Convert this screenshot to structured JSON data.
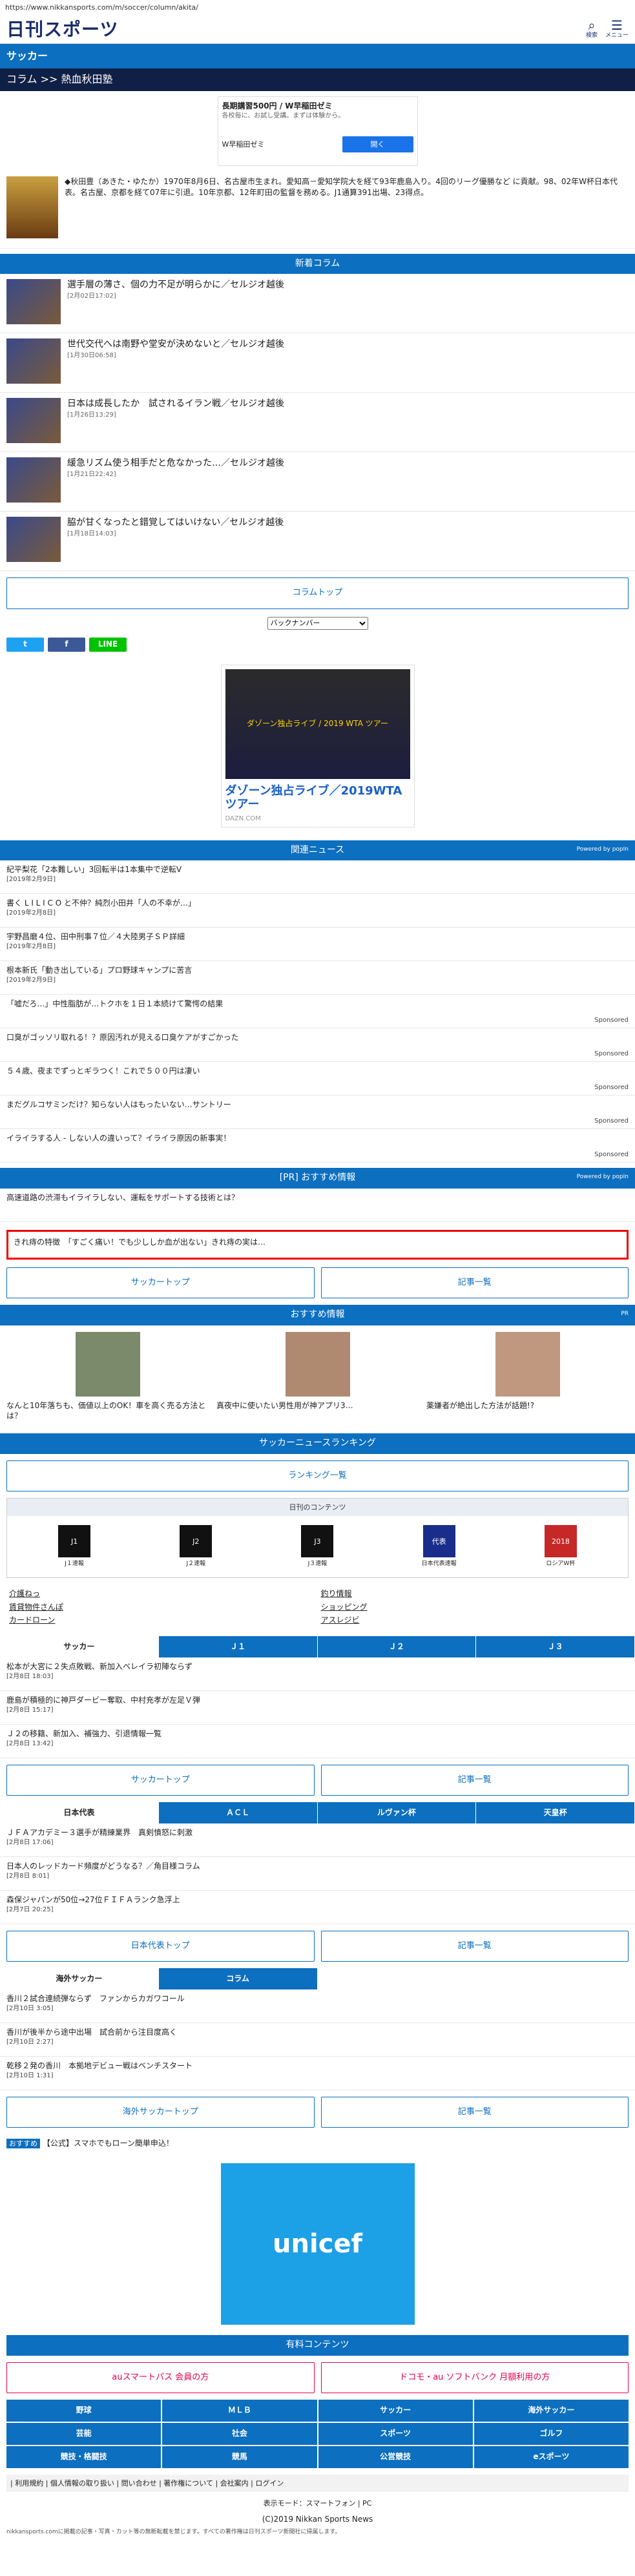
{
  "browser": {
    "url": "https://www.nikkansports.com/m/soccer/column/akita/"
  },
  "header": {
    "logo": "日刊スポーツ",
    "search_label": "検索",
    "menu_label": "メニュー"
  },
  "section": {
    "title": "サッカー",
    "breadcrumb": "コラム >> 熱血秋田塾"
  },
  "ad_top": {
    "title": "長期講習500円 / W早稲田ゼミ",
    "desc": "各校毎に、お試し受講。まずは体験から。",
    "advertiser": "W早稲田ゼミ",
    "cta": "開く"
  },
  "profile": {
    "text": "◆秋田豊（あきた・ゆたか）1970年8月6日、名古屋市生まれ。愛知高－愛知学院大を経て93年鹿島入り。4回のリーグ優勝など に貢献。98、02年W杯日本代表。名古屋、京都を経て07年に引退。10年京都、12年町田の監督を務める。J1通算391出場、23得点。"
  },
  "columns": {
    "title": "新着コラム",
    "items": [
      {
        "title": "選手層の薄さ、個の力不足が明らかに／セルジオ越後",
        "date": "[2月02日17:02]"
      },
      {
        "title": "世代交代へは南野や堂安が決めないと／セルジオ越後",
        "date": "[1月30日06:58]"
      },
      {
        "title": "日本は成長したか　試されるイラン戦／セルジオ越後",
        "date": "[1月26日13:29]"
      },
      {
        "title": "緩急リズム使う相手だと危なかった…／セルジオ越後",
        "date": "[1月21日22:42]"
      },
      {
        "title": "脇が甘くなったと錯覚してはいけない／セルジオ越後",
        "date": "[1月18日14:03]"
      }
    ],
    "top_button": "コラムトップ"
  },
  "backnumber": {
    "label": "バックナンバー"
  },
  "share": {
    "twitter": "t",
    "facebook": "f",
    "line": "LINE"
  },
  "banner_ad": {
    "image_text": "ダゾーン独占ライブ / 2019 WTA ツアー",
    "title": "ダゾーン独占ライブ／2019WTAツアー",
    "source": "DAZN.COM"
  },
  "related": {
    "title": "関連ニュース",
    "powered": "Powered by popIn",
    "items": [
      {
        "title": "紀平梨花「2本難しい」3回転半は1本集中で逆転V",
        "date": "[2019年2月9日]",
        "sponsored": ""
      },
      {
        "title": "書く L I L I C O と不仲？純烈小田井「人の不幸が…」",
        "date": "[2019年2月8日]",
        "sponsored": ""
      },
      {
        "title": "宇野昌磨４位、田中刑事７位／４大陸男子ＳＰ詳細",
        "date": "[2019年2月8日]",
        "sponsored": ""
      },
      {
        "title": "根本新氏「動き出している」プロ野球キャンプに苦言",
        "date": "[2019年2月9日]",
        "sponsored": ""
      },
      {
        "title": "「嘘だろ…」中性脂肪が…トクホを１日１本続けて驚愕の結果",
        "date": "",
        "sponsored": "Sponsored"
      },
      {
        "title": "口臭がゴッソリ取れる！？原因汚れが見える口臭ケアがすごかった",
        "date": "",
        "sponsored": "Sponsored"
      },
      {
        "title": "５４歳、夜までずっとギラつく！これで５００円は凄い",
        "date": "",
        "sponsored": "Sponsored"
      },
      {
        "title": "まだグルコサミンだけ？知らない人はもったいない…サントリー",
        "date": "",
        "sponsored": "Sponsored"
      },
      {
        "title": "イライラする人 - しない人の違いって？イライラ原因の新事実！",
        "date": "",
        "sponsored": "Sponsored"
      }
    ]
  },
  "pr": {
    "title": "[PR] おすすめ情報",
    "powered": "Powered by popIn",
    "item": "高速道路の渋滞もイライラしない、運転をサポートする技術とは？"
  },
  "red_box": {
    "text": "きれ痔の特徴　「すごく痛い！でも少ししか血が出ない」きれ痔の実は…"
  },
  "nav1": {
    "left": "サッカートップ",
    "right": "記事一覧"
  },
  "osusume": {
    "title": "おすすめ情報",
    "pr": "PR",
    "items": [
      {
        "text": "なんと10年落ちも、価値以上のOK！車を高く売る方法とは？"
      },
      {
        "text": "真夜中に使いたい男性用が神アプリ3…"
      },
      {
        "text": "薬嫌者が絶出した方法が話題!?"
      }
    ]
  },
  "ranking": {
    "title": "サッカーニュースランキング",
    "button": "ランキング一覧"
  },
  "mycontent": {
    "title": "日刊のコンテンツ",
    "logos": [
      {
        "badge": "J1",
        "label": "J１速報"
      },
      {
        "badge": "J2",
        "label": "J２速報"
      },
      {
        "badge": "J3",
        "label": "J３速報"
      },
      {
        "badge": "代表",
        "label": "日本代表速報"
      },
      {
        "badge": "2018",
        "label": "ロシアW杯"
      }
    ]
  },
  "links": [
    {
      "label": "介護ねっ"
    },
    {
      "label": "釣り情報"
    },
    {
      "label": "賃貸物件さんぽ"
    },
    {
      "label": "ショッピング"
    },
    {
      "label": "カードローン"
    },
    {
      "label": "アスレジビ"
    }
  ],
  "tabs1": {
    "labels": [
      "サッカー",
      "Ｊ１",
      "Ｊ２",
      "Ｊ３"
    ]
  },
  "soccer_news": [
    {
      "title": "松本が大宮に２失点敗戦、新加入ベレイラ初陣ならず",
      "date": "[2月8日 18:03]"
    },
    {
      "title": "鹿島が積極的に神戸ダービー奪取、中村充孝が左足Ｖ弾",
      "date": "[2月8日 15:17]"
    },
    {
      "title": "Ｊ２の移籍、新加入、補強力、引退情報一覧",
      "date": "[2月8日 13:42]"
    }
  ],
  "nav2": {
    "left": "サッカートップ",
    "right": "記事一覧"
  },
  "tabs2": {
    "labels": [
      "日本代表",
      "ＡＣＬ",
      "ルヴァン杯",
      "天皇杯"
    ]
  },
  "japan_news": [
    {
      "title": "ＪＦＡアカデミー３選手が精練業界　真剣憤怒に刺激",
      "date": "[2月8日 17:06]"
    },
    {
      "title": "日本人のレッドカード頻度がどうなる？／角目様コラム",
      "date": "[2月8日 8:01]"
    },
    {
      "title": "森保ジャパンが50位→27位ＦＩＦＡランク急浮上",
      "date": "[2月7日 20:25]"
    }
  ],
  "nav3": {
    "left": "日本代表トップ",
    "right": "記事一覧"
  },
  "tabs3": {
    "labels": [
      "海外サッカー",
      "コラム"
    ]
  },
  "overseas_news": [
    {
      "title": "香川２試合連続弾ならず　ファンからカガワコール",
      "date": "[2月10日 3:05]"
    },
    {
      "title": "香川が後半から途中出場　試合前から注目度高く",
      "date": "[2月10日 2:27]"
    },
    {
      "title": "乾移２発の香川　本拠地デビュー戦はベンチスタート",
      "date": "[2月10日 1:31]"
    }
  ],
  "nav4": {
    "left": "海外サッカートップ",
    "right": "記事一覧"
  },
  "osusume_bar": {
    "badge": "おすすめ",
    "text": "【公式】スマホでもローン簡単申込！"
  },
  "unicef": {
    "text": "unicef"
  },
  "paid": {
    "title": "有料コンテンツ",
    "left": "auスマートパス 会員の方",
    "right": "ドコモ・au ソフトバンク 月額利用の方"
  },
  "menu": {
    "labels": [
      "野球",
      "ＭＬＢ",
      "サッカー",
      "海外サッカー",
      "芸能",
      "社会",
      "スポーツ",
      "ゴルフ",
      "競技・格闘技",
      "競馬",
      "公営競技",
      "eスポーツ"
    ]
  },
  "footer": {
    "links": "| 利用規約 | 個人情報の取り扱い | 問い合わせ | 著作権について | 会社案内 | ログイン",
    "mode": "表示モード：スマートフォン | PC",
    "copyright": "(C)2019 Nikkan Sports News",
    "note": "nikkansports.comに掲載の記事・写真・カット等の無断転載を禁じます。すべての著作権は日刊スポーツ新聞社に帰属します。"
  }
}
